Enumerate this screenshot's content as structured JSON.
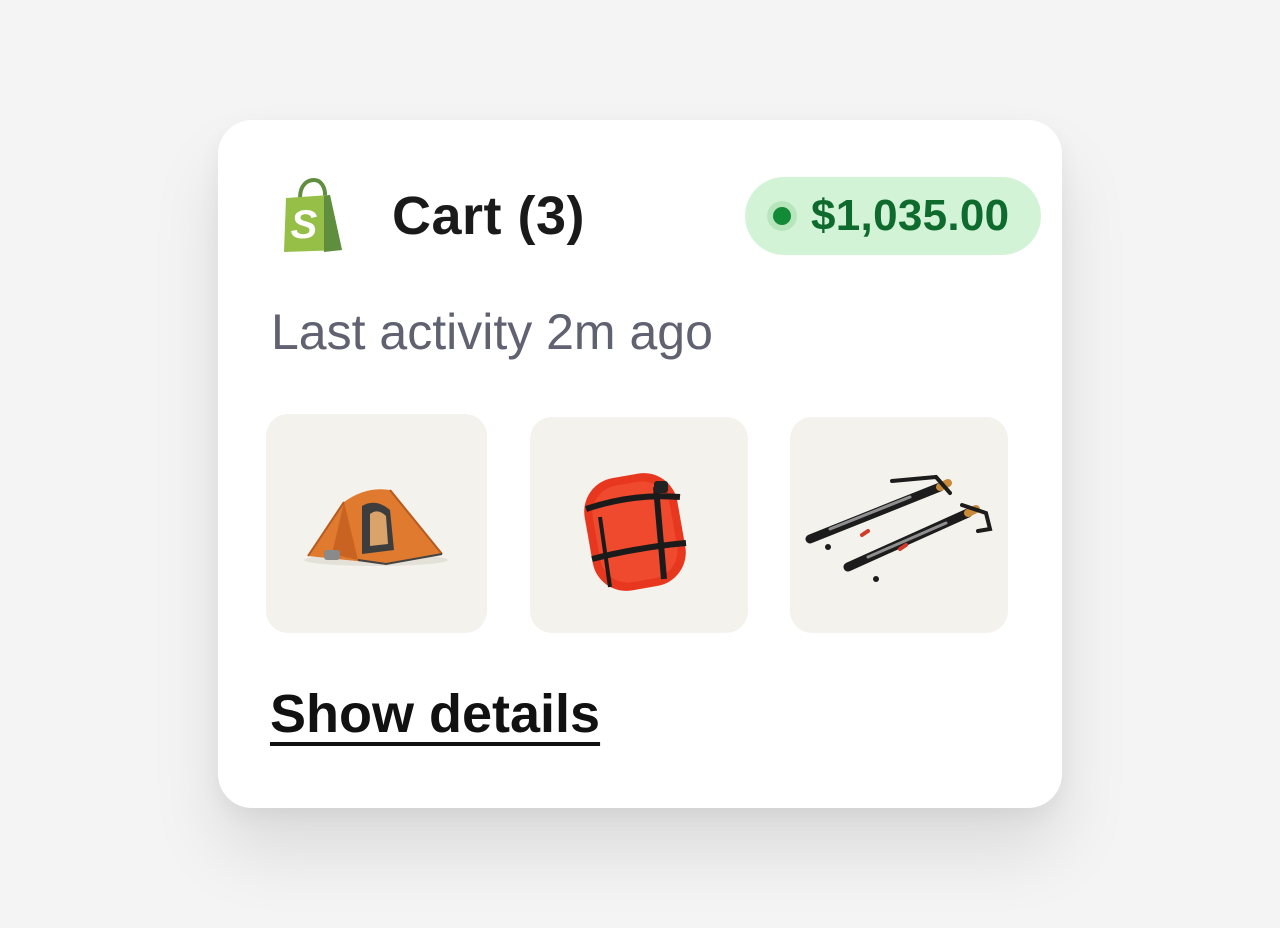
{
  "cart": {
    "title": "Cart (3)",
    "total": "$1,035.00",
    "last_activity": "Last activity 2m ago",
    "show_details_label": "Show details",
    "status_color": "#138a36",
    "brand_color": "#95bf47",
    "items": [
      {
        "icon": "tent-icon"
      },
      {
        "icon": "sleeping-bag-icon"
      },
      {
        "icon": "trekking-poles-icon"
      }
    ]
  }
}
